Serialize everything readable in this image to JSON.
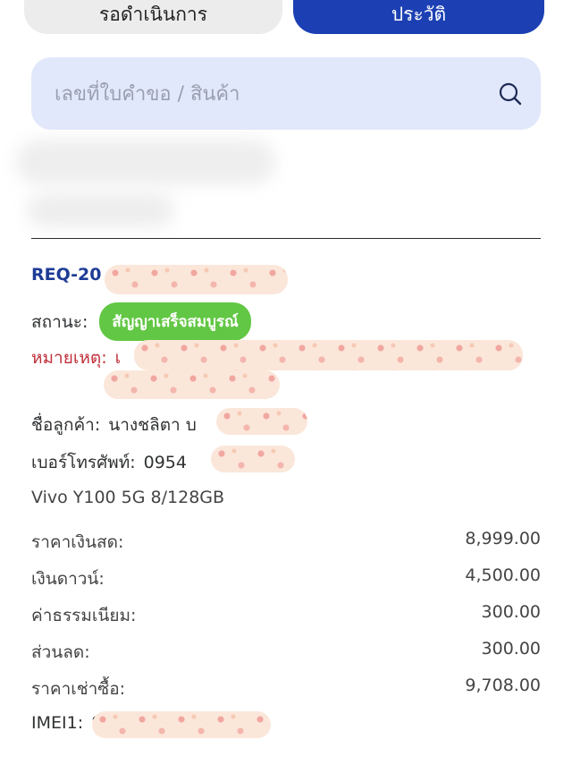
{
  "tabs": {
    "pending_label": "รอดำเนินการ",
    "history_label": "ประวัติ"
  },
  "search": {
    "placeholder": "เลขที่ใบคำขอ / สินค้า"
  },
  "request": {
    "id_prefix": "REQ-20",
    "status_label": "สถานะ:",
    "status_value": "สัญญาเสร็จสมบูรณ์",
    "status_color": "#62c744",
    "note_label": "หมายเหตุ:",
    "note_prefix": "เ",
    "customer_label": "ชื่อลูกค้า:",
    "customer_value": "นางชลิตา บ",
    "phone_label": "เบอร์โทรศัพท์:",
    "phone_value": "0954",
    "product": "Vivo Y100 5G 8/128GB",
    "prices": [
      {
        "label": "ราคาเงินสด:",
        "amount": "8,999.00"
      },
      {
        "label": "เงินดาวน์:",
        "amount": "4,500.00"
      },
      {
        "label": "ค่าธรรมเนียม:",
        "amount": "300.00"
      },
      {
        "label": "ส่วนลด:",
        "amount": "300.00"
      },
      {
        "label": "ราคาเช่าซื้อ:",
        "amount": "9,708.00"
      }
    ],
    "imei_label": "IMEI1:",
    "imei_prefix": "8"
  },
  "colors": {
    "primary": "#1c40b4",
    "accent_red": "#c0303a",
    "id_blue": "#1e3c96"
  },
  "icons": {
    "search": "search-icon"
  }
}
